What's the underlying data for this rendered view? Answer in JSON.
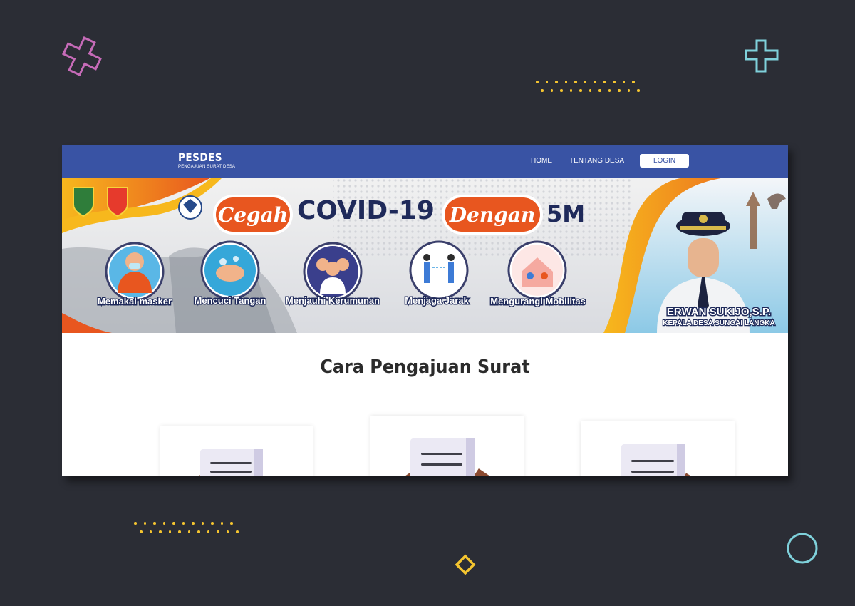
{
  "navbar": {
    "brand_name": "PESDES",
    "brand_subtitle": "PENGAJUAN SURAT DESA",
    "links": [
      "HOME",
      "TENTANG DESA"
    ],
    "login_label": "LOGIN"
  },
  "banner": {
    "headline_part1": "Cegah",
    "headline_main": "COVID-19",
    "headline_part2": "Dengan",
    "headline_tag": "5M",
    "measures": [
      "Memakai masker",
      "Mencuci Tangan",
      "Menjauhi Kerumunan",
      "Menjaga Jarak",
      "Mengurangi Mobilitas"
    ],
    "official_name": "ERWAN SUKIJO,S.P.",
    "official_title": "KEPALA DESA SUNGAI LANGKA"
  },
  "main": {
    "section_title": "Cara Pengajuan Surat"
  },
  "colors": {
    "background": "#2b2d35",
    "navbar": "#3953a4",
    "banner_orange": "#e8561f",
    "banner_yellow": "#f7b81d",
    "deco_pink": "#c66bb8",
    "deco_cyan": "#7fd1db",
    "deco_yellow": "#f5c530"
  }
}
